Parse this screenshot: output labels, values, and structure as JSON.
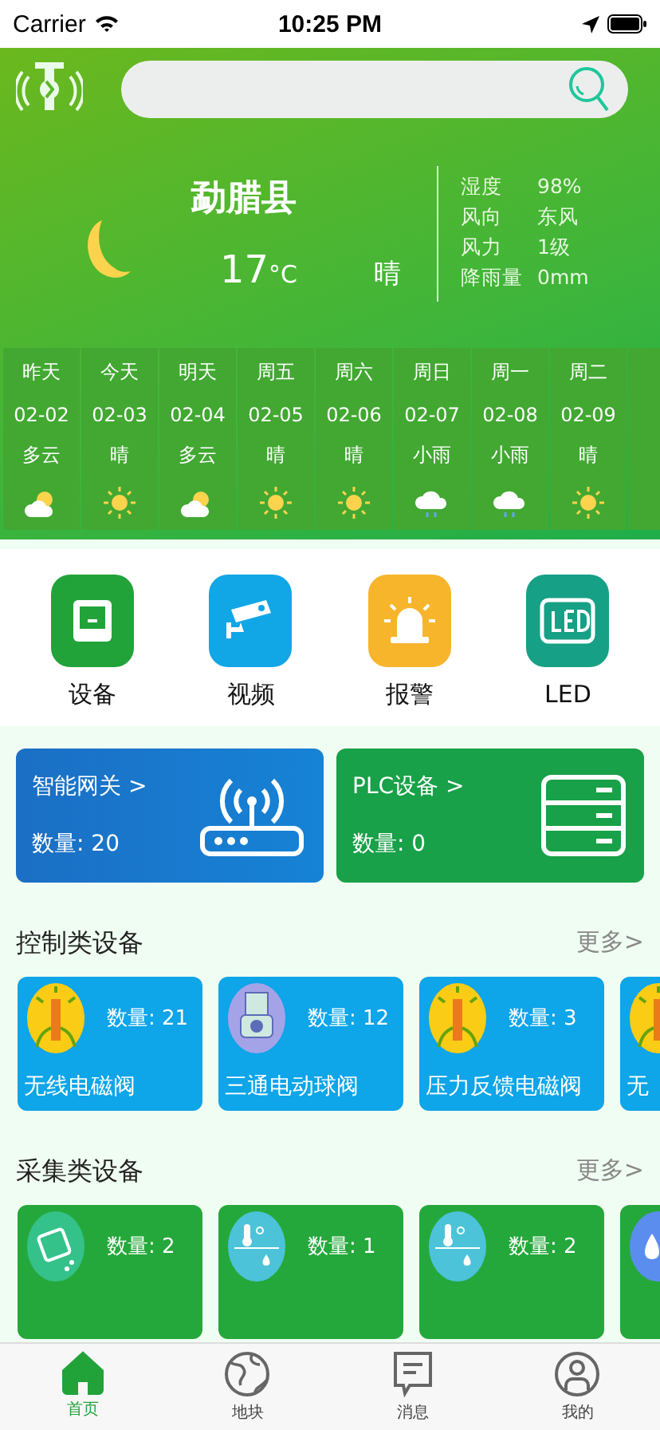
{
  "status_bar": {
    "carrier": "Carrier",
    "time": "10:25 PM"
  },
  "weather": {
    "city": "勐腊县",
    "temperature": "17",
    "unit": "°C",
    "condition": "晴",
    "details": [
      {
        "label": "湿度",
        "value": "98%"
      },
      {
        "label": "风向",
        "value": "东风"
      },
      {
        "label": "风力",
        "value": "1级"
      },
      {
        "label": "降雨量",
        "value": "0mm"
      }
    ]
  },
  "forecast": [
    {
      "day": "昨天",
      "date": "02-02",
      "condition": "多云",
      "kind": "cloudy"
    },
    {
      "day": "今天",
      "date": "02-03",
      "condition": "晴",
      "kind": "sunny"
    },
    {
      "day": "明天",
      "date": "02-04",
      "condition": "多云",
      "kind": "cloudy"
    },
    {
      "day": "周五",
      "date": "02-05",
      "condition": "晴",
      "kind": "sunny"
    },
    {
      "day": "周六",
      "date": "02-06",
      "condition": "晴",
      "kind": "sunny"
    },
    {
      "day": "周日",
      "date": "02-07",
      "condition": "小雨",
      "kind": "rain"
    },
    {
      "day": "周一",
      "date": "02-08",
      "condition": "小雨",
      "kind": "rain"
    },
    {
      "day": "周二",
      "date": "02-09",
      "condition": "晴",
      "kind": "sunny"
    }
  ],
  "quick_actions": [
    {
      "label": "设备",
      "kind": "device",
      "color": "#22a33a"
    },
    {
      "label": "视频",
      "kind": "camera",
      "color": "#11a6e6"
    },
    {
      "label": "报警",
      "kind": "alarm",
      "color": "#f7b52c"
    },
    {
      "label": "LED",
      "kind": "led",
      "color": "#16a085"
    }
  ],
  "gateways": [
    {
      "title": "智能网关 >",
      "count": "数量: 20",
      "kind": "router"
    },
    {
      "title": "PLC设备 >",
      "count": "数量: 0",
      "kind": "server"
    }
  ],
  "sections": [
    {
      "title": "控制类设备",
      "more": "更多>",
      "kind": "control",
      "items": [
        {
          "name": "无线电磁阀",
          "count": "数量: 21",
          "kind": "sprinkler"
        },
        {
          "name": "三通电动球阀",
          "count": "数量: 12",
          "kind": "valve"
        },
        {
          "name": "压力反馈电磁阀",
          "count": "数量: 3",
          "kind": "sprinkler"
        },
        {
          "name": "无",
          "kind": "sprinkler"
        }
      ]
    },
    {
      "title": "采集类设备",
      "more": "更多>",
      "kind": "collect",
      "items": [
        {
          "count": "数量: 2",
          "kind": "soil"
        },
        {
          "count": "数量: 1",
          "kind": "thermo"
        },
        {
          "count": "数量: 2",
          "kind": "thermo"
        },
        {
          "kind": "drops"
        }
      ]
    }
  ],
  "tab_bar": [
    {
      "label": "首页",
      "kind": "home",
      "selected": true
    },
    {
      "label": "地块",
      "kind": "globe",
      "selected": false
    },
    {
      "label": "消息",
      "kind": "message",
      "selected": false
    },
    {
      "label": "我的",
      "kind": "user",
      "selected": false
    }
  ]
}
